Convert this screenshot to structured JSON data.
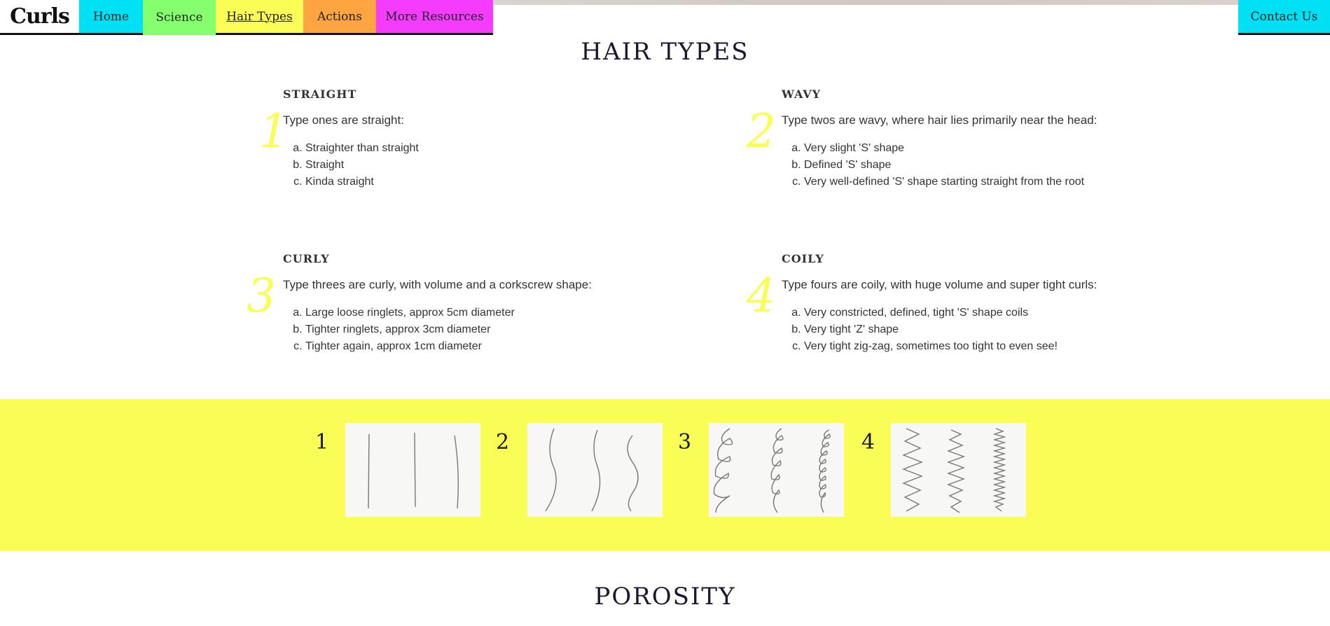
{
  "nav": {
    "logo": "Curls",
    "items": [
      {
        "label": "Home"
      },
      {
        "label": "Science"
      },
      {
        "label": "Hair Types"
      },
      {
        "label": "Actions"
      },
      {
        "label": "More Resources"
      }
    ],
    "contact": "Contact Us"
  },
  "page": {
    "title": "HAIR TYPES",
    "next_title": "POROSITY"
  },
  "types": [
    {
      "number": "1",
      "heading": "STRAIGHT",
      "description": "Type ones are straight:",
      "items": [
        "Straighter than straight",
        "Straight",
        "Kinda straight"
      ]
    },
    {
      "number": "2",
      "heading": "WAVY",
      "description": "Type twos are wavy, where hair lies primarily near the head:",
      "items": [
        "Very slight 'S' shape",
        "Defined 'S' shape",
        "Very well-defined 'S' shape starting straight from the root"
      ]
    },
    {
      "number": "3",
      "heading": "CURLY",
      "description": "Type threes are curly, with volume and a corkscrew shape:",
      "items": [
        "Large loose ringlets, approx 5cm diameter",
        "Tighter ringlets, approx 3cm diameter",
        "Tighter again, approx 1cm diameter"
      ]
    },
    {
      "number": "4",
      "heading": "COILY",
      "description": "Type fours are coily, with huge volume and super tight curls:",
      "items": [
        "Very constricted, defined, tight 'S' shape coils",
        "Very tight 'Z' shape",
        "Very tight zig-zag, sometimes too tight to even see!"
      ]
    }
  ],
  "illustrations": {
    "labels": [
      "1",
      "2",
      "3",
      "4"
    ],
    "icons": [
      "straight-hair-sketch",
      "wavy-hair-sketch",
      "curly-hair-sketch",
      "coily-hair-sketch"
    ]
  },
  "colors": {
    "cyan": "#00e0f4",
    "green": "#86ff6e",
    "yellow": "#fafd55",
    "orange": "#fea441",
    "magenta": "#f43cff"
  }
}
